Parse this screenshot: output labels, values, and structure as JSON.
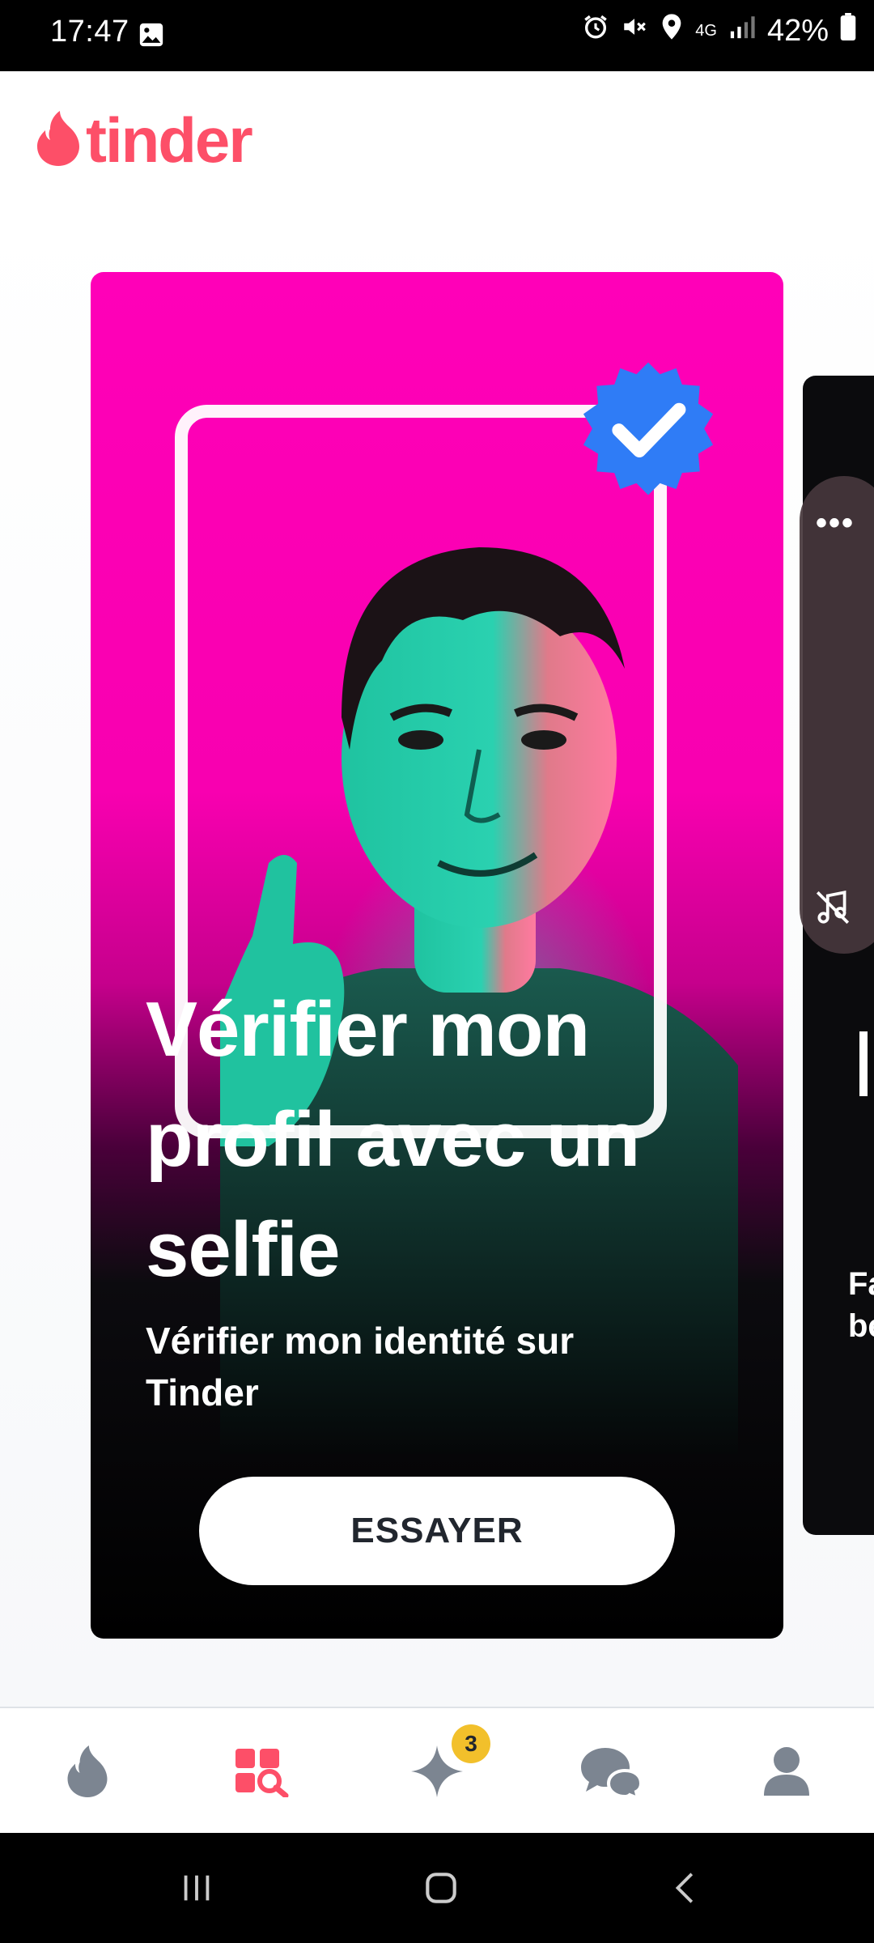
{
  "status_bar": {
    "time": "17:47",
    "network": "4G",
    "battery": "42%"
  },
  "app": {
    "logo_text": "tinder",
    "brand_color": "#fd4f68"
  },
  "promo_card": {
    "title": "Vérifier mon profil avec un selfie",
    "subtitle": "Vérifier mon identité sur Tinder",
    "button_label": "ESSAYER"
  },
  "next_card": {
    "partial_text_line1": "Fa",
    "partial_text_line2": "be"
  },
  "tab_bar": {
    "tabs": [
      {
        "id": "swipe",
        "icon": "flame-icon",
        "active": false
      },
      {
        "id": "explore",
        "icon": "explore-icon",
        "active": true
      },
      {
        "id": "gold",
        "icon": "sparkle-icon",
        "active": false,
        "badge": "3"
      },
      {
        "id": "messages",
        "icon": "chat-icon",
        "active": false
      },
      {
        "id": "profile",
        "icon": "profile-icon",
        "active": false
      }
    ]
  },
  "colors": {
    "active_tab": "#fd4f68",
    "inactive_tab": "#7c8591",
    "badge": "#f2c02b",
    "verified_blue": "#2f7cf6"
  }
}
